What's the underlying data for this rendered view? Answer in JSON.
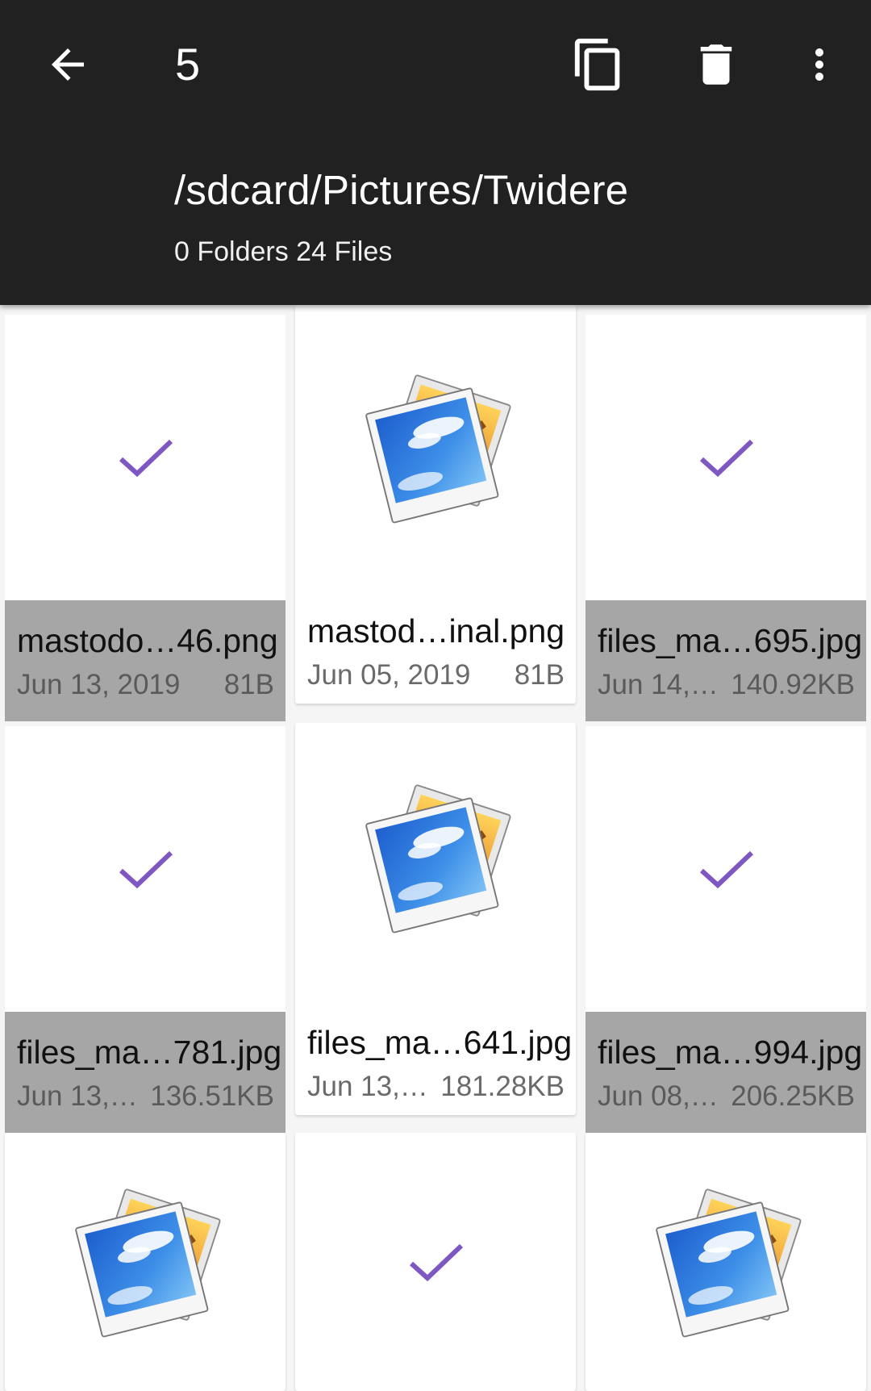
{
  "appbar": {
    "back_icon": "arrow-back-icon",
    "selected_count": "5",
    "copy_icon": "copy-icon",
    "delete_icon": "trash-icon",
    "more_icon": "more-vert-icon",
    "path": "/sdcard/Pictures/Twidere",
    "counts": "0 Folders 24 Files"
  },
  "colors": {
    "appbar_bg": "#212121",
    "selected_footer": "#a6a6a6",
    "check_purple": "#7e57c2"
  },
  "files": [
    {
      "name": "mastodo…46.png",
      "date": "Jun 13, 2019",
      "size": "81B",
      "selected": true,
      "icon": "check-icon"
    },
    {
      "name": "mastod…inal.png",
      "date": "Jun 05, 2019",
      "size": "81B",
      "selected": false,
      "icon": "image-file-icon"
    },
    {
      "name": "files_ma…695.jpg",
      "date": "Jun 14,…",
      "size": "140.92KB",
      "selected": true,
      "icon": "check-icon"
    },
    {
      "name": "files_ma…781.jpg",
      "date": "Jun 13,…",
      "size": "136.51KB",
      "selected": true,
      "icon": "check-icon"
    },
    {
      "name": "files_ma…641.jpg",
      "date": "Jun 13,…",
      "size": "181.28KB",
      "selected": false,
      "icon": "image-file-icon"
    },
    {
      "name": "files_ma…994.jpg",
      "date": "Jun 08,…",
      "size": "206.25KB",
      "selected": true,
      "icon": "check-icon"
    },
    {
      "name": "",
      "date": "",
      "size": "",
      "selected": false,
      "icon": "image-file-icon"
    },
    {
      "name": "",
      "date": "",
      "size": "",
      "selected": true,
      "icon": "check-icon"
    },
    {
      "name": "",
      "date": "",
      "size": "",
      "selected": false,
      "icon": "image-file-icon"
    }
  ]
}
